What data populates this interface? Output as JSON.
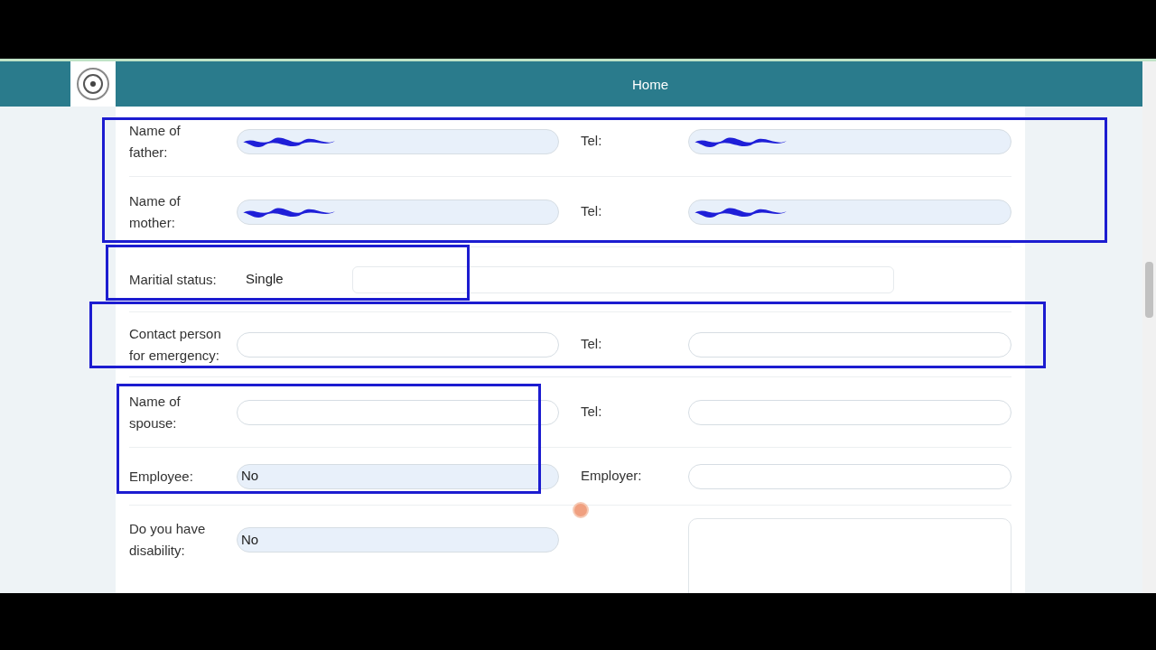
{
  "header": {
    "title": "Home"
  },
  "rows": [
    {
      "kind": "pair",
      "label": "Name of\nfather:",
      "field": {
        "redacted": true
      },
      "right_label": "Tel:",
      "right_field": {
        "redacted": true
      }
    },
    {
      "kind": "pair",
      "label": "Name of\nmother:",
      "field": {
        "redacted": true
      },
      "right_label": "Tel:",
      "right_field": {
        "redacted": true
      }
    },
    {
      "kind": "status",
      "label": "Maritial status:",
      "value": "Single"
    },
    {
      "kind": "pair",
      "label": "Contact person\nfor emergency:",
      "field": {
        "redacted": false
      },
      "right_label": "Tel:",
      "right_field": {
        "redacted": false
      }
    },
    {
      "kind": "pair",
      "label": "Name of\nspouse:",
      "field": {
        "redacted": false
      },
      "right_label": "Tel:",
      "right_field": {
        "redacted": false
      }
    },
    {
      "kind": "pair",
      "label": "Employee:",
      "field": {
        "redacted": false,
        "value": "No"
      },
      "right_label": "Employer:",
      "right_field": {
        "redacted": false
      }
    },
    {
      "kind": "textarea",
      "label": "Do you have\ndisability:",
      "field": {
        "redacted": false,
        "value": "No"
      }
    }
  ]
}
